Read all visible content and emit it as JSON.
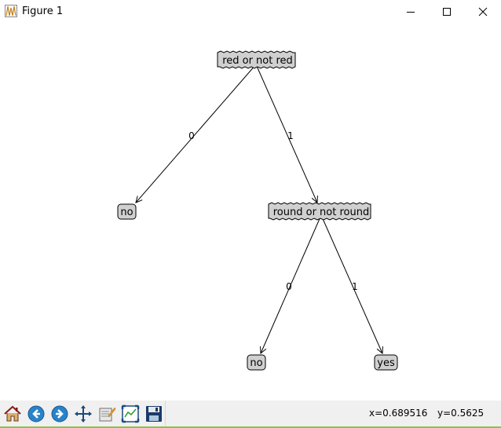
{
  "window": {
    "title": "Figure 1"
  },
  "tree": {
    "root": {
      "label": "red or not red"
    },
    "node2": {
      "label": "round or not round"
    },
    "leaves": [
      {
        "label": "no"
      },
      {
        "label": "no"
      },
      {
        "label": "yes"
      }
    ],
    "edges": [
      {
        "label": "0"
      },
      {
        "label": "1"
      },
      {
        "label": "0"
      },
      {
        "label": "1"
      }
    ],
    "colors": {
      "decision_fill": "#d0d0d0",
      "leaf_fill": "#d0d0d0",
      "edge": "#000000"
    }
  },
  "toolbar": {
    "buttons": [
      "home-icon",
      "back-icon",
      "forward-icon",
      "pan-icon",
      "subplots-icon",
      "zoom-icon",
      "save-icon"
    ],
    "x_readout": "x=0.689516",
    "y_readout": "y=0.5625"
  }
}
